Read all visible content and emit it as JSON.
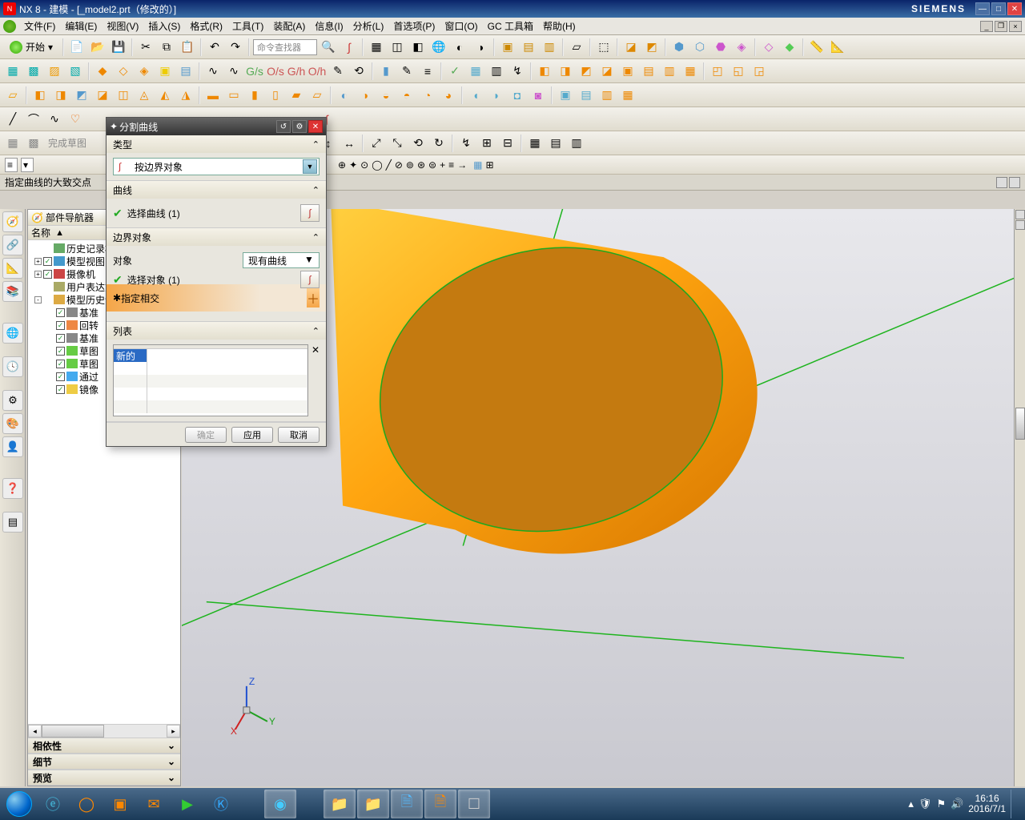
{
  "titlebar": {
    "app": "NX 8",
    "module": "建模",
    "file": "[_model2.prt（修改的）]",
    "brand": "SIEMENS"
  },
  "menu": {
    "items": [
      "文件(F)",
      "编辑(E)",
      "视图(V)",
      "插入(S)",
      "格式(R)",
      "工具(T)",
      "装配(A)",
      "信息(I)",
      "分析(L)",
      "首选项(P)",
      "窗口(O)",
      "GC 工具箱",
      "帮助(H)"
    ]
  },
  "toolbar1": {
    "start": "开始",
    "cmdfinder_placeholder": "命令查找器"
  },
  "finish_sketch": "完成草图",
  "prompt": "指定曲线的大致交点",
  "navigator": {
    "title": "部件导航器",
    "col_name": "名称",
    "nodes": [
      {
        "indent": 0,
        "exp": "",
        "chk": "",
        "ico": "#6a6",
        "label": "历史记录模"
      },
      {
        "indent": 0,
        "exp": "+",
        "chk": "✓",
        "ico": "#49c",
        "label": "模型视图"
      },
      {
        "indent": 0,
        "exp": "+",
        "chk": "✓",
        "ico": "#c44",
        "label": "摄像机"
      },
      {
        "indent": 0,
        "exp": "",
        "chk": "",
        "ico": "#aa6",
        "label": "用户表达式"
      },
      {
        "indent": 0,
        "exp": "-",
        "chk": "",
        "ico": "#da4",
        "label": "模型历史记"
      },
      {
        "indent": 1,
        "exp": "",
        "chk": "✓",
        "ico": "#888",
        "label": "基准"
      },
      {
        "indent": 1,
        "exp": "",
        "chk": "✓",
        "ico": "#e84",
        "label": "回转"
      },
      {
        "indent": 1,
        "exp": "",
        "chk": "✓",
        "ico": "#888",
        "label": "基准"
      },
      {
        "indent": 1,
        "exp": "",
        "chk": "✓",
        "ico": "#6c4",
        "label": "草图"
      },
      {
        "indent": 1,
        "exp": "",
        "chk": "✓",
        "ico": "#6c4",
        "label": "草图"
      },
      {
        "indent": 1,
        "exp": "",
        "chk": "✓",
        "ico": "#4ae",
        "label": "通过"
      },
      {
        "indent": 1,
        "exp": "",
        "chk": "✓",
        "ico": "#ec4",
        "label": "镜像"
      }
    ],
    "sections": [
      "相依性",
      "细节",
      "预览"
    ]
  },
  "dialog": {
    "title": "分割曲线",
    "sec_type": "类型",
    "type_option": "按边界对象",
    "sec_curve": "曲线",
    "select_curve": "选择曲线  (1)",
    "sec_bound": "边界对象",
    "object_label": "对象",
    "object_option": "现有曲线",
    "select_object": "选择对象  (1)",
    "specify_intersect": "指定相交",
    "sec_list": "列表",
    "list_item": "新的",
    "btn_ok": "确定",
    "btn_apply": "应用",
    "btn_cancel": "取消"
  },
  "taskbar": {
    "time": "16:16",
    "date": "2016/7/1"
  }
}
